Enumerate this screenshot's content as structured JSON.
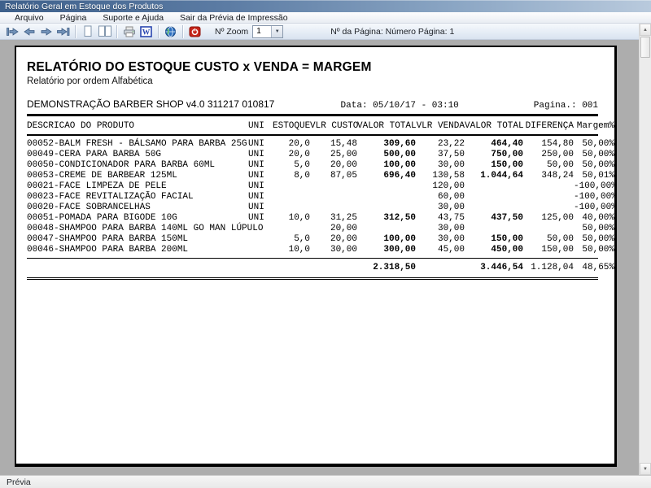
{
  "window": {
    "title": "Relatório Geral em Estoque dos Produtos"
  },
  "menu": {
    "items": [
      "Arquivo",
      "Página",
      "Suporte e Ajuda",
      "Sair da Prévia de Impressão"
    ]
  },
  "toolbar": {
    "icons": [
      "first-page-icon",
      "prev-page-icon",
      "next-page-icon",
      "last-page-icon",
      "single-page-view-icon",
      "two-page-view-icon",
      "print-icon",
      "word-export-icon",
      "html-export-icon",
      "exit-icon"
    ],
    "zoom_label": "Nº Zoom",
    "zoom_value": "1",
    "page_info": "Nº da Página: Número Página: 1"
  },
  "report": {
    "title": "RELATÓRIO DO ESTOQUE CUSTO x VENDA = MARGEM",
    "subtitle": "Relatório por ordem Alfabética",
    "company": "DEMONSTRAÇÃO BARBER SHOP v4.0 311217 010817",
    "date_label": "Data: 05/10/17 - 03:10",
    "page_label": "Pagina.: 001",
    "columns": [
      "DESCRICAO DO PRODUTO",
      "UNI",
      "ESTOQUE",
      "VLR CUSTO",
      "VALOR TOTAL",
      "VLR VENDA",
      "VALOR TOTAL",
      "DIFERENÇA",
      "Margem%"
    ],
    "rows": [
      {
        "descricao": "00052-BALM FRESH - BÁLSAMO PARA BARBA 25G",
        "uni": "UNI",
        "estoque": "20,0",
        "vlr_custo": "15,48",
        "valor_total_custo": "309,60",
        "vlr_venda": "23,22",
        "valor_total_venda": "464,40",
        "diferenca": "154,80",
        "margem": "50,00%"
      },
      {
        "descricao": "00049-CERA PARA BARBA 50G",
        "uni": "UNI",
        "estoque": "20,0",
        "vlr_custo": "25,00",
        "valor_total_custo": "500,00",
        "vlr_venda": "37,50",
        "valor_total_venda": "750,00",
        "diferenca": "250,00",
        "margem": "50,00%"
      },
      {
        "descricao": "00050-CONDICIONADOR PARA BARBA 60ML",
        "uni": "UNI",
        "estoque": "5,0",
        "vlr_custo": "20,00",
        "valor_total_custo": "100,00",
        "vlr_venda": "30,00",
        "valor_total_venda": "150,00",
        "diferenca": "50,00",
        "margem": "50,00%"
      },
      {
        "descricao": "00053-CREME DE BARBEAR 125ML",
        "uni": "UNI",
        "estoque": "8,0",
        "vlr_custo": "87,05",
        "valor_total_custo": "696,40",
        "vlr_venda": "130,58",
        "valor_total_venda": "1.044,64",
        "diferenca": "348,24",
        "margem": "50,01%"
      },
      {
        "descricao": "00021-FACE LIMPEZA DE PELE",
        "uni": "UNI",
        "estoque": "",
        "vlr_custo": "",
        "valor_total_custo": "",
        "vlr_venda": "120,00",
        "valor_total_venda": "",
        "diferenca": "",
        "margem": "-100,00%"
      },
      {
        "descricao": "00023-FACE REVITALIZAÇÃO FACIAL",
        "uni": "UNI",
        "estoque": "",
        "vlr_custo": "",
        "valor_total_custo": "",
        "vlr_venda": "60,00",
        "valor_total_venda": "",
        "diferenca": "",
        "margem": "-100,00%"
      },
      {
        "descricao": "00020-FACE SOBRANCELHAS",
        "uni": "UNI",
        "estoque": "",
        "vlr_custo": "",
        "valor_total_custo": "",
        "vlr_venda": "30,00",
        "valor_total_venda": "",
        "diferenca": "",
        "margem": "-100,00%"
      },
      {
        "descricao": "00051-POMADA PARA BIGODE 10G",
        "uni": "UNI",
        "estoque": "10,0",
        "vlr_custo": "31,25",
        "valor_total_custo": "312,50",
        "vlr_venda": "43,75",
        "valor_total_venda": "437,50",
        "diferenca": "125,00",
        "margem": "40,00%"
      },
      {
        "descricao": "00048-SHAMPOO PARA BARBA 140ML GO MAN LÚPULO",
        "uni": "",
        "estoque": "",
        "vlr_custo": "20,00",
        "valor_total_custo": "",
        "vlr_venda": "30,00",
        "valor_total_venda": "",
        "diferenca": "",
        "margem": "50,00%"
      },
      {
        "descricao": "00047-SHAMPOO PARA BARBA 150ML",
        "uni": "",
        "estoque": "5,0",
        "vlr_custo": "20,00",
        "valor_total_custo": "100,00",
        "vlr_venda": "30,00",
        "valor_total_venda": "150,00",
        "diferenca": "50,00",
        "margem": "50,00%"
      },
      {
        "descricao": "00046-SHAMPOO PARA BARBA 200ML",
        "uni": "",
        "estoque": "10,0",
        "vlr_custo": "30,00",
        "valor_total_custo": "300,00",
        "vlr_venda": "45,00",
        "valor_total_venda": "450,00",
        "diferenca": "150,00",
        "margem": "50,00%"
      }
    ],
    "totals": {
      "descricao": "",
      "uni": "",
      "estoque": "",
      "vlr_custo": "",
      "valor_total_custo": "2.318,50",
      "vlr_venda": "",
      "valor_total_venda": "3.446,54",
      "diferenca": "1.128,04",
      "margem": "48,65%"
    }
  },
  "status": {
    "text": "Prévia"
  },
  "colors": {
    "titlebar_left": "#3f618c",
    "canvas_gray": "#adadad",
    "exit_red": "#c6261b",
    "arrow_blue": "#7292b8"
  }
}
